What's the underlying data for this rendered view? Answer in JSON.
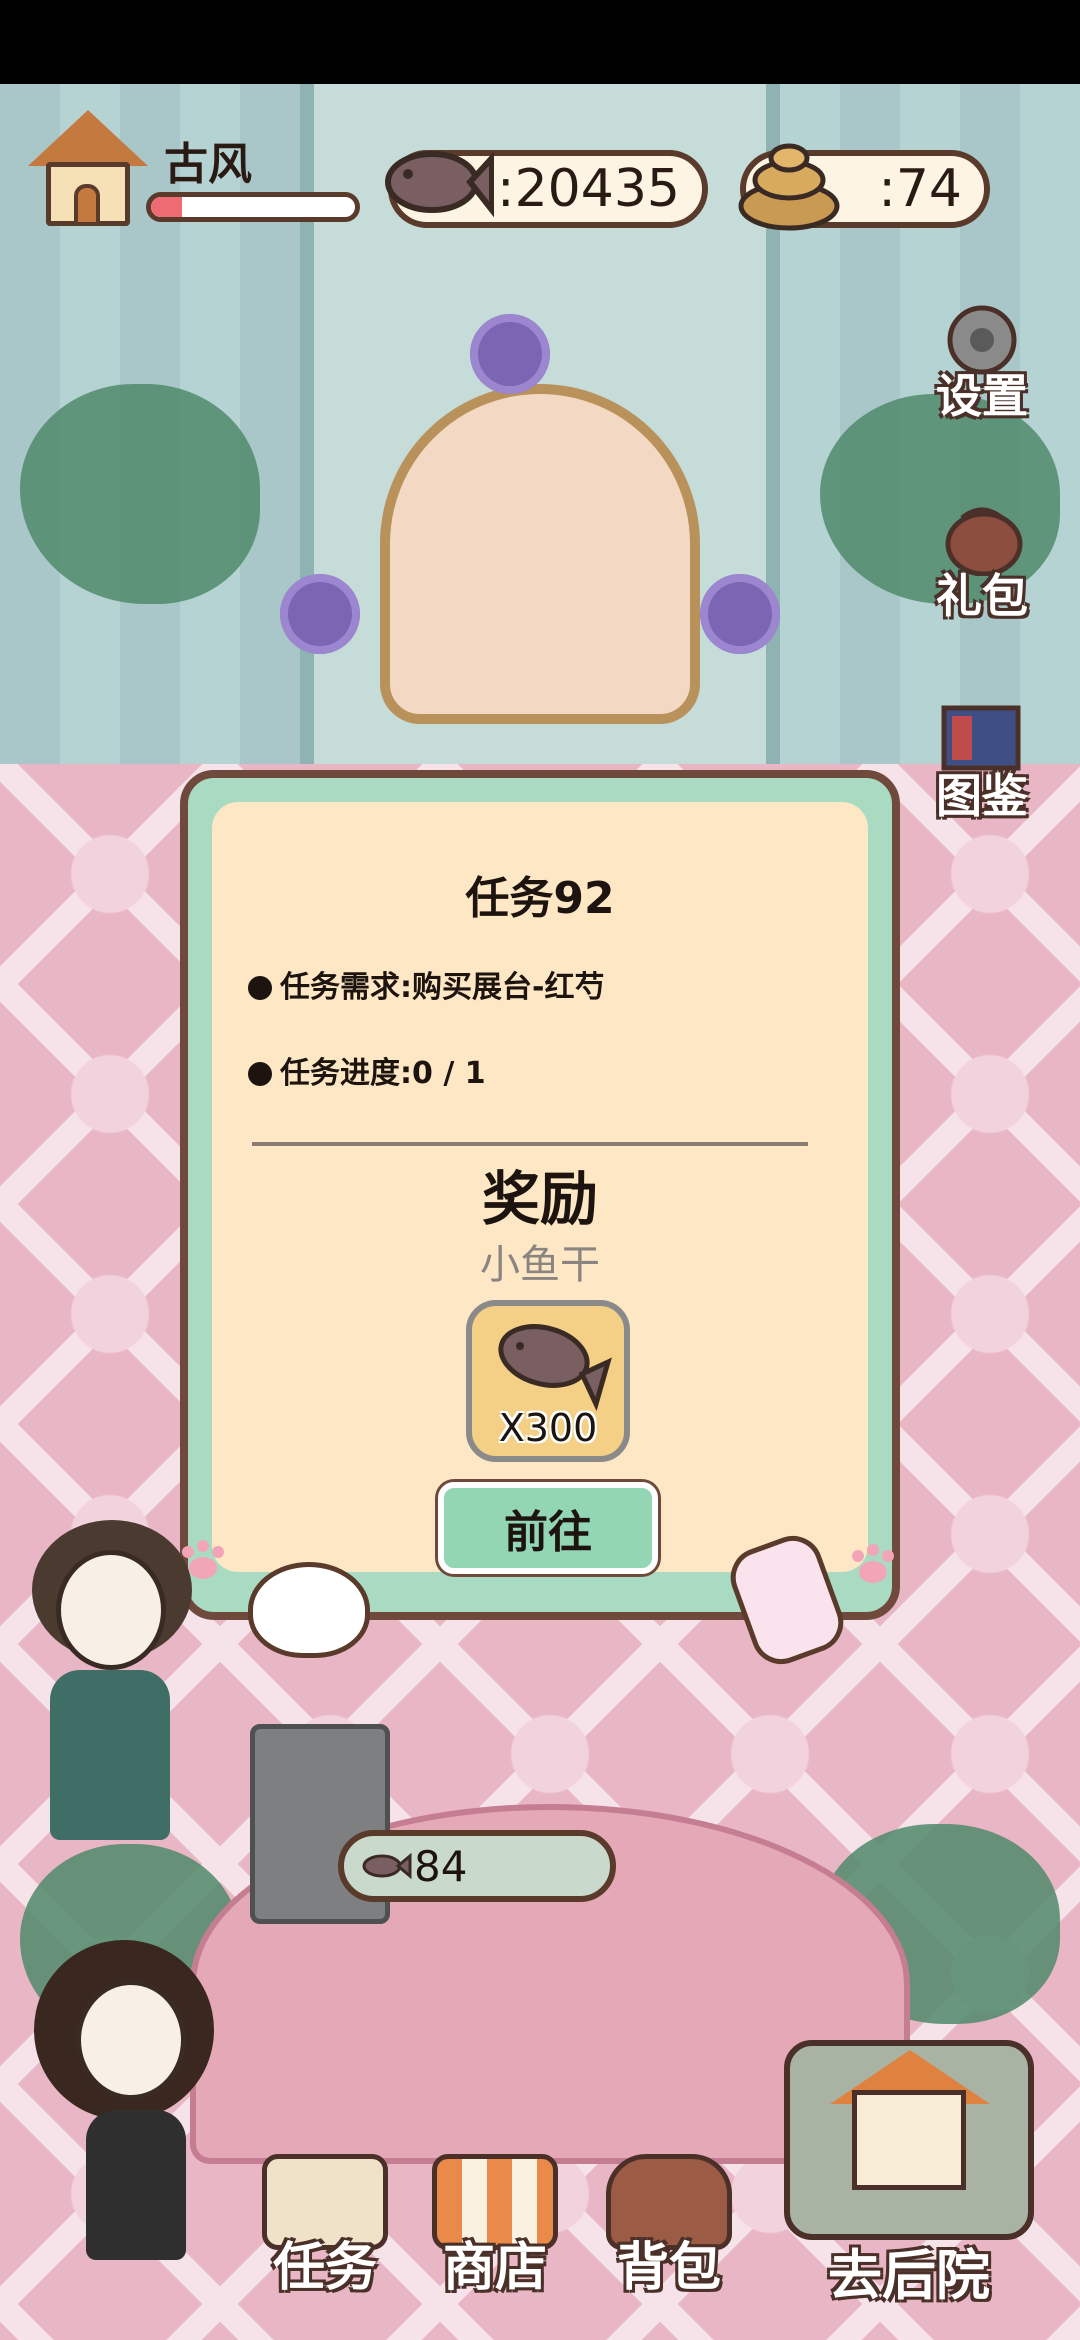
{
  "hud": {
    "scene_name": "古风",
    "scene_progress": 0.15,
    "fish_count": ":20435",
    "poop_count": ":74"
  },
  "side_menu": {
    "settings_label": "设置",
    "gift_label": "礼包",
    "catalog_label": "图鉴"
  },
  "task": {
    "title": "任务92",
    "requirement": "任务需求:购买展台-红芍",
    "progress": "任务进度:0 / 1",
    "reward_title": "奖励",
    "reward_name": "小鱼干",
    "reward_count": "X300",
    "go_label": "前往"
  },
  "table_counter": "84",
  "bottom_nav": {
    "task_label": "任务",
    "shop_label": "商店",
    "bag_label": "背包",
    "backyard_label": "去后院"
  },
  "colors": {
    "modal_frame": "#a9dbc2",
    "modal_panel": "#fde7c5",
    "go_button": "#93d6b4",
    "progress_fill": "#ef6b73"
  }
}
